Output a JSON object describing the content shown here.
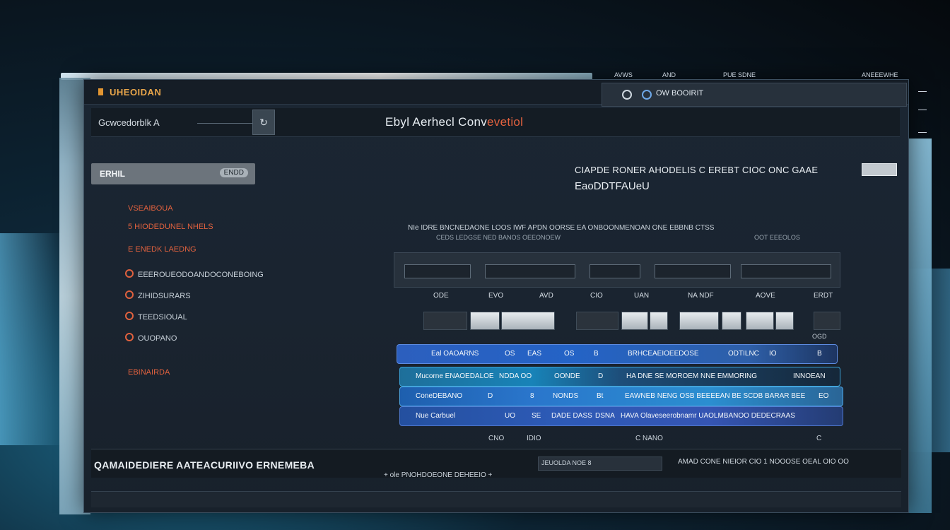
{
  "window": {
    "app_title": "UHEOIDAN",
    "top_menu": [
      "AVWS",
      "AND",
      "PUE SDNE",
      "ANEEEWHE"
    ],
    "top_right_label": "OW BOOIRIT"
  },
  "addressbar": {
    "text": "Gcwcedorblk A",
    "page_title_main": "Ebyl Aerhecl Conv",
    "page_title_accent": "evetiol",
    "button_icon": "refresh-icon"
  },
  "sidebar": {
    "search_label": "ERHIL",
    "search_button": "ENDD",
    "items": [
      {
        "label": "VSEAIBOUA",
        "style": "red",
        "icon": false
      },
      {
        "label": "5 HIODEDUNEL NHELS",
        "style": "red",
        "icon": false
      },
      {
        "label": "E ENEDK LAEDNG",
        "style": "red",
        "icon": false
      },
      {
        "label": "EEEROUEODOANDOCONEBOING",
        "style": "gray",
        "icon": true
      },
      {
        "label": "ZIHIDSURARS",
        "style": "gray",
        "icon": true
      },
      {
        "label": "TEEDSIOUAL",
        "style": "gray",
        "icon": true
      },
      {
        "label": "OUOPANO",
        "style": "gray",
        "icon": true
      },
      {
        "label": "EBINAIRDA",
        "style": "red",
        "icon": false
      }
    ]
  },
  "main": {
    "headline1": "CIAPDE RONER AHODELIS C EREBT CIOC ONC GAAE",
    "headline2": "EaoDDTFAUeU",
    "sub_line1": "NIe    IDRE BNCNEDAONE LOOS IWF APDN OORSE EA ONBOONMENOAN ONE EBBNB CTSS",
    "sub_line2": "CEDS LEDGSE NED BANOS OEEONOEW",
    "sub_right": "OOT EEEOLOS",
    "column_labels": [
      "ODE",
      "EVO",
      "AVD",
      "CIO",
      "UAN",
      "NA NDF",
      "AOVE",
      "ERDT"
    ],
    "small_label": "OGD",
    "rows": [
      {
        "cells": [
          "Eal OAOARNS",
          "OS",
          "EAS",
          "OS",
          "B",
          "BRHCEAEIOEEDOSE",
          "ODTILNC",
          "IO",
          "B"
        ]
      },
      {
        "cells": [
          "Mucorne ENAOEDALOE",
          "NDDA OO",
          "OONDE",
          "D",
          "HA DNE SE MOROEM NNE EMMORING",
          "INNOEAN"
        ]
      },
      {
        "cells": [
          "ConeDEBANO",
          "D",
          "8",
          "NONDS",
          "Bt",
          "EAWNEB NENG OSB BEEEEAN BE SCDB BARAR BEE",
          "EO"
        ]
      },
      {
        "cells": [
          "Nue Carbuel",
          "UO",
          "SE",
          "DADE DASS",
          "DSNA",
          "HAVA Olaveseerobnamr UAOLMBANOO DEDECRAAS"
        ]
      }
    ],
    "bottom_small": [
      "CNO",
      "IDIO",
      "C NANO",
      "C"
    ]
  },
  "footer": {
    "title": "QAMAIDEDIERE AATEACURIIVO ERNEMEBA",
    "mid_text": "JEUOLDA NOE 8",
    "right_text": "AMAD CONE NIEIOR CIO 1   NOOOSE OEAL OIO OO",
    "sub": "+ ole PNOHDOEONE DEHEEIO +"
  },
  "colors": {
    "accent_orange": "#e29531",
    "accent_red": "#e0613e",
    "row_blue": "#2463c6"
  }
}
